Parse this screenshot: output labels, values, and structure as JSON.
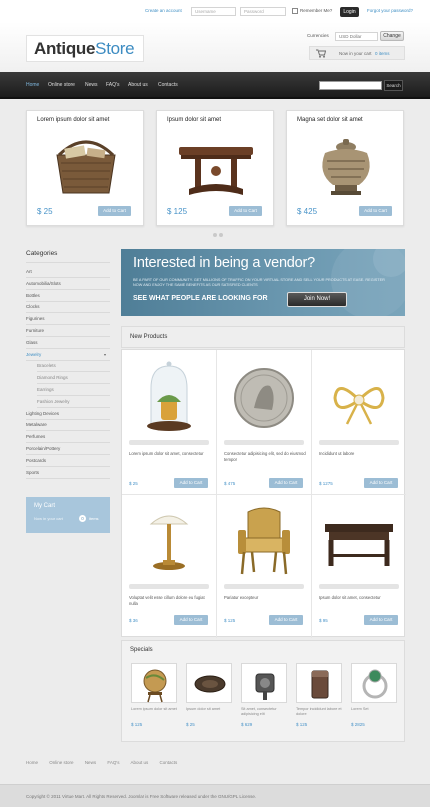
{
  "colors": {
    "accent": "#3f8fc4",
    "price": "#4893c8",
    "button": "#9cbdd5",
    "nav": "#2a2a2a"
  },
  "topbar": {
    "create_account": "Create an account",
    "username_placeholder": "Username",
    "password_placeholder": "Password",
    "remember_label": "Remember Me?",
    "login_label": "Login",
    "forgot_label": "Forgot your password?"
  },
  "header": {
    "logo_part1": "Antique",
    "logo_part2": "Store",
    "currencies_label": "Currencies",
    "currency_value": "USD Dollar",
    "change_label": "Change",
    "cart_text": "Now in your cart",
    "cart_items": "0 items"
  },
  "nav": {
    "items": [
      "Home",
      "Online store",
      "News",
      "FAQ's",
      "About us",
      "Contacts"
    ],
    "search_label": "Search"
  },
  "featured": [
    {
      "title": "Lorem ipsum dolor sit amet",
      "price": "$ 25",
      "button": "Add to Cart",
      "icon": "wicker-basket-icon"
    },
    {
      "title": "Ipsum dolor sit amet",
      "price": "$ 125",
      "button": "Add to Cart",
      "icon": "antique-table-icon"
    },
    {
      "title": "Magna set dolor sit amet",
      "price": "$ 425",
      "button": "Add to Cart",
      "icon": "antique-urn-icon"
    }
  ],
  "sidebar": {
    "title": "Categories",
    "categories": [
      "Art",
      "Automobilia/Slots",
      "Bottles",
      "Clocks",
      "Figurines",
      "Furniture",
      "Glass",
      "Jewelry",
      "Bracelets",
      "Diamond Rings",
      "Earrings",
      "Fashion Jewelry",
      "Lighting Devices",
      "Metalware",
      "Perfumes",
      "Porcelain/Pottery",
      "Postcards",
      "Sports"
    ],
    "cart_title": "My Cart",
    "cart_text": "Now in your cart",
    "cart_count": "0",
    "cart_items_label": "items"
  },
  "banner": {
    "headline": "Interested in being a vendor?",
    "body": "BE A PART OF OUR COMMUNITY. GET MILLIONS OF TRAFFIC ON YOUR VIRTUAL STORE AND SELL YOUR PRODUCTS AT EASE. REGISTER NOW AND ENJOY THE SAME BENEFITS AS OUR SATISFIED CLIENTS",
    "strap": "SEE WHAT PEOPLE ARE LOOKING FOR",
    "button": "Join Now!"
  },
  "new_products": {
    "title": "New Products",
    "items": [
      {
        "name": "Lorem ipsum dolor sit amet, consectetur",
        "price": "$ 25",
        "button": "Add to Cart",
        "icon": "glass-dome-icon"
      },
      {
        "name": "Consectetur adipisicing elit, sed do eiusmod tempor",
        "price": "$ 475",
        "button": "Add to Cart",
        "icon": "coin-icon"
      },
      {
        "name": "Incididunt ut labore",
        "price": "$ 1275",
        "button": "Add to Cart",
        "icon": "jewelry-bow-icon"
      },
      {
        "name": "Voluptat velit esse cillum dolore eu fugiat nulla",
        "price": "$ 36",
        "button": "Add to Cart",
        "icon": "desk-lamp-icon"
      },
      {
        "name": "Pariatur excepteur",
        "price": "$ 125",
        "button": "Add to Cart",
        "icon": "armchair-icon"
      },
      {
        "name": "Ipsum dolor sit amet, consectetur",
        "price": "$ 95",
        "button": "Add to Cart",
        "icon": "low-table-icon"
      }
    ]
  },
  "specials": {
    "title": "Specials",
    "items": [
      {
        "name": "Lorem ipsum dolor sit amet",
        "price": "$ 125",
        "icon": "globe-icon"
      },
      {
        "name": "Ipsum dolor sit amet",
        "price": "$ 25",
        "icon": "brooch-icon"
      },
      {
        "name": "Sit amet, consectetur adipisicing elit",
        "price": "$ 629",
        "icon": "tool-icon"
      },
      {
        "name": "Tempor incididunt labore et dolore",
        "price": "$ 125",
        "icon": "lighter-icon"
      },
      {
        "name": "Lorem Set",
        "price": "$ 2825",
        "icon": "ring-icon"
      }
    ]
  },
  "footer": {
    "links": [
      "Home",
      "Online store",
      "News",
      "FAQ's",
      "About us",
      "Contacts"
    ],
    "copyright": "Copyright © 2011 Virtue Mart. All Rights Reserved. Joomla! is Free Software released under the GNU/GPL License."
  }
}
